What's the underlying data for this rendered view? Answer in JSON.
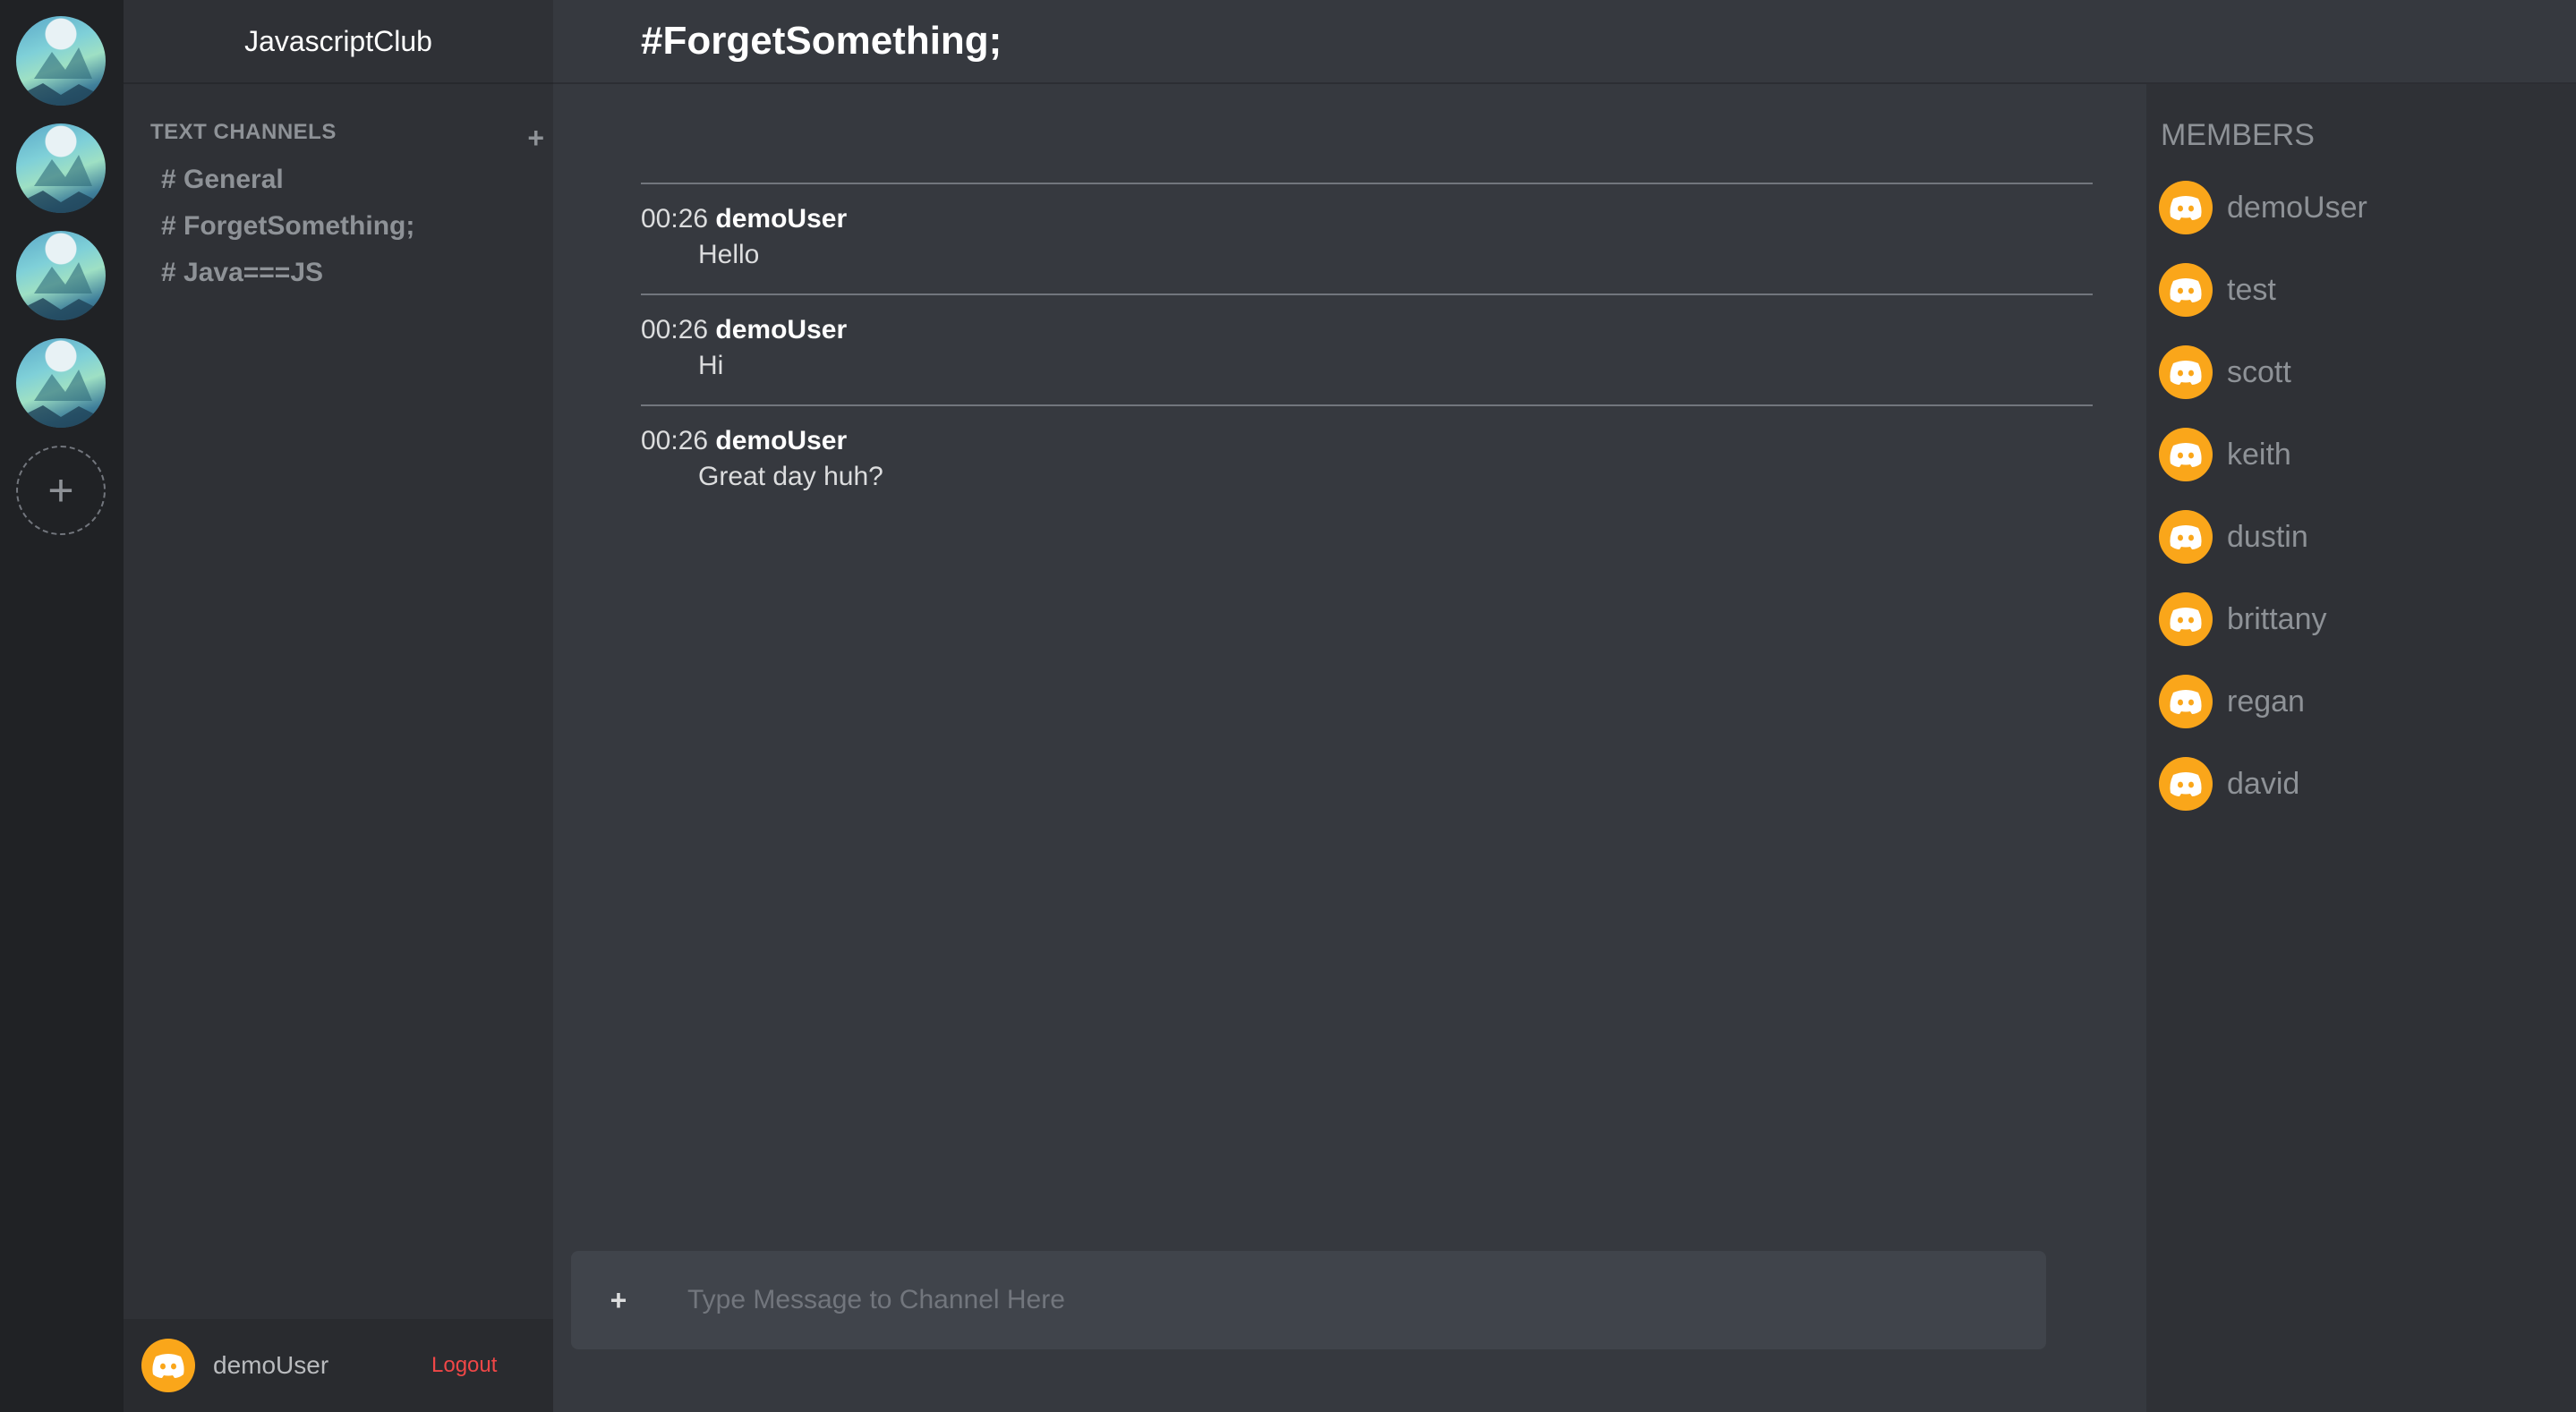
{
  "servers": [
    {
      "name": "server-1"
    },
    {
      "name": "server-2"
    },
    {
      "name": "server-3"
    },
    {
      "name": "server-4"
    }
  ],
  "add_server": {
    "icon": "plus-icon",
    "glyph": "+"
  },
  "guild": {
    "name": "JavascriptClub"
  },
  "channels": {
    "category": "TEXT CHANNELS",
    "add_glyph": "+",
    "items": [
      {
        "label": "# General"
      },
      {
        "label": "# ForgetSomething;"
      },
      {
        "label": "# Java===JS"
      }
    ]
  },
  "user_bar": {
    "username": "demoUser",
    "logout": "Logout"
  },
  "chat": {
    "title": "#ForgetSomething;",
    "messages": [
      {
        "time": "00:26",
        "author": "demoUser",
        "text": "Hello"
      },
      {
        "time": "00:26",
        "author": "demoUser",
        "text": "Hi"
      },
      {
        "time": "00:26",
        "author": "demoUser",
        "text": "Great day huh?"
      }
    ],
    "composer": {
      "plus": "+",
      "placeholder": "Type Message to Channel Here"
    }
  },
  "members": {
    "title": "MEMBERS",
    "list": [
      {
        "name": "demoUser"
      },
      {
        "name": "test"
      },
      {
        "name": "scott"
      },
      {
        "name": "keith"
      },
      {
        "name": "dustin"
      },
      {
        "name": "brittany"
      },
      {
        "name": "regan"
      },
      {
        "name": "david"
      }
    ]
  },
  "colors": {
    "accent_avatar": "#faa61a",
    "logout": "#f04747",
    "background": "#36393f",
    "sidebar": "#2f3136"
  }
}
